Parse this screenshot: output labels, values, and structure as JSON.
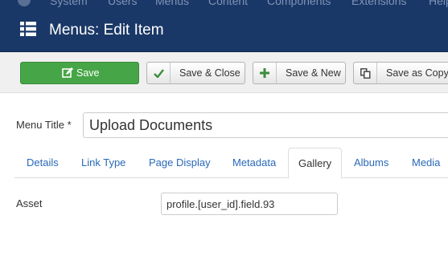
{
  "topbar": {
    "items": [
      "System",
      "Users",
      "Menus",
      "Content",
      "Components",
      "Extensions",
      "Help"
    ]
  },
  "header": {
    "icon": "list-icon",
    "title": "Menus: Edit Item"
  },
  "toolbar": {
    "save_label": "Save",
    "save_close_label": "Save & Close",
    "save_new_label": "Save & New",
    "save_copy_label": "Save as Copy"
  },
  "form": {
    "menu_title_label": "Menu Title *",
    "menu_title_value": "Upload Documents",
    "asset_label": "Asset",
    "asset_value": "profile.[user_id].field.93"
  },
  "tabs": [
    {
      "label": "Details"
    },
    {
      "label": "Link Type"
    },
    {
      "label": "Page Display"
    },
    {
      "label": "Metadata"
    },
    {
      "label": "Gallery",
      "active": true
    },
    {
      "label": "Albums"
    },
    {
      "label": "Media"
    }
  ],
  "colors": {
    "header_bg": "#1a3867",
    "save_green": "#46a546",
    "link_blue": "#2a69b8"
  }
}
